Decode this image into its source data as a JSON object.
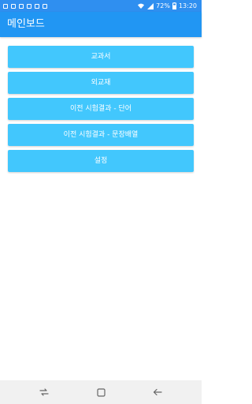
{
  "status_bar": {
    "battery": "72%",
    "time": "13:20"
  },
  "app_bar": {
    "title": "메인보드"
  },
  "menu": {
    "items": [
      {
        "label": "교과서"
      },
      {
        "label": "외교재"
      },
      {
        "label": "이전 시험결과 - 단어"
      },
      {
        "label": "이전 시험결과 - 문장배열"
      },
      {
        "label": "설정"
      }
    ]
  },
  "nav_bar": {
    "icons": [
      "recent-apps-icon",
      "home-icon",
      "back-icon"
    ]
  },
  "colors": {
    "status_bar": "#2f8ff0",
    "app_bar": "#2196f3",
    "button": "#42c7fd",
    "nav_bar": "#f1f1f1"
  }
}
